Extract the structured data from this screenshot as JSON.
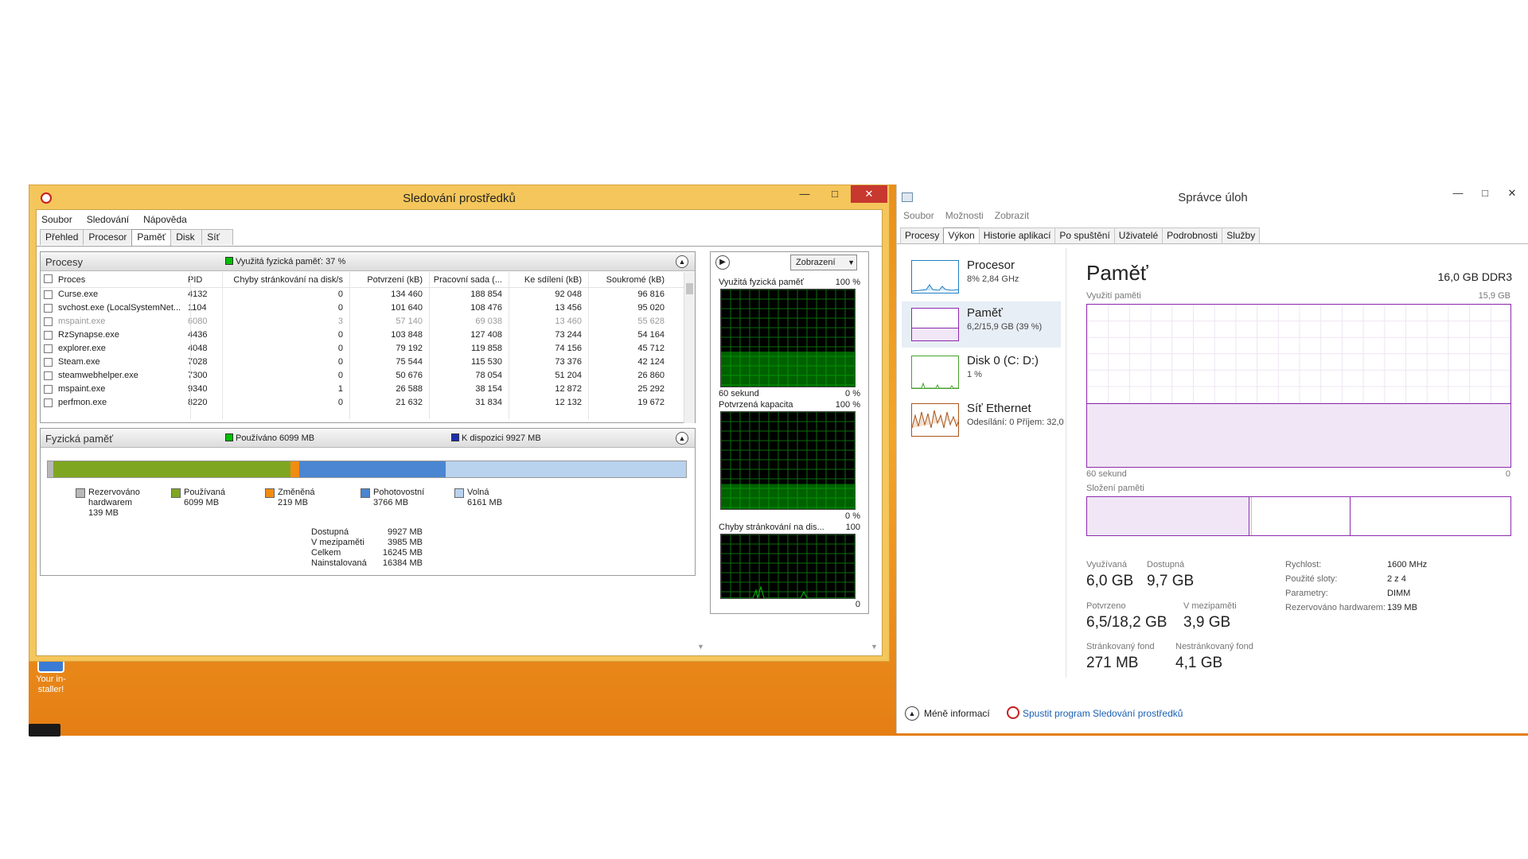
{
  "resmon": {
    "title": "Sledování prostředků",
    "menu": [
      "Soubor",
      "Sledování",
      "Nápověda"
    ],
    "tabs": [
      "Přehled",
      "Procesor",
      "Paměť",
      "Disk",
      "Síť"
    ],
    "active_tab": "Paměť",
    "processes": {
      "title": "Procesy",
      "legend": "Využitá fyzická paměť: 37 %",
      "legend_color": "#00c000",
      "columns": {
        "name": "Proces",
        "pid": "PID",
        "faults": "Chyby stránkování na disk/s",
        "commit": "Potvrzení (kB)",
        "ws": "Pracovní sada (...",
        "share": "Ke sdílení (kB)",
        "priv": "Soukromé (kB)"
      },
      "rows": [
        {
          "name": "Curse.exe",
          "pid": "4132",
          "faults": "0",
          "commit": "134 460",
          "ws": "188 854",
          "share": "92 048",
          "priv": "96 816",
          "dim": false
        },
        {
          "name": "svchost.exe (LocalSystemNet...",
          "pid": "1104",
          "faults": "0",
          "commit": "101 640",
          "ws": "108 476",
          "share": "13 456",
          "priv": "95 020",
          "dim": false
        },
        {
          "name": "mspaint.exe",
          "pid": "6080",
          "faults": "3",
          "commit": "57 140",
          "ws": "69 038",
          "share": "13 460",
          "priv": "55 628",
          "dim": true
        },
        {
          "name": "RzSynapse.exe",
          "pid": "4436",
          "faults": "0",
          "commit": "103 848",
          "ws": "127 408",
          "share": "73 244",
          "priv": "54 164",
          "dim": false
        },
        {
          "name": "explorer.exe",
          "pid": "4048",
          "faults": "0",
          "commit": "79 192",
          "ws": "119 858",
          "share": "74 156",
          "priv": "45 712",
          "dim": false
        },
        {
          "name": "Steam.exe",
          "pid": "7028",
          "faults": "0",
          "commit": "75 544",
          "ws": "115 530",
          "share": "73 376",
          "priv": "42 124",
          "dim": false
        },
        {
          "name": "steamwebhelper.exe",
          "pid": "7300",
          "faults": "0",
          "commit": "50 676",
          "ws": "78 054",
          "share": "51 204",
          "priv": "26 860",
          "dim": false
        },
        {
          "name": "mspaint.exe",
          "pid": "9340",
          "faults": "1",
          "commit": "26 588",
          "ws": "38 154",
          "share": "12 872",
          "priv": "25 292",
          "dim": false
        },
        {
          "name": "perfmon.exe",
          "pid": "8220",
          "faults": "0",
          "commit": "21 632",
          "ws": "31 834",
          "share": "12 132",
          "priv": "19 672",
          "dim": false
        }
      ]
    },
    "physical": {
      "title": "Fyzická paměť",
      "legend_used": "Používáno 6099 MB",
      "legend_used_color": "#00c000",
      "legend_avail": "K dispozici 9927 MB",
      "legend_avail_color": "#1a2fb0",
      "categories": [
        {
          "label": "Rezervováno hardwarem",
          "value_text": "139 MB",
          "mb": 139,
          "color": "#b8b8b8"
        },
        {
          "label": "Používaná",
          "value_text": "6099 MB",
          "mb": 6099,
          "color": "#7fa620"
        },
        {
          "label": "Změněná",
          "value_text": "219 MB",
          "mb": 219,
          "color": "#f08c12"
        },
        {
          "label": "Pohotovostní",
          "value_text": "3766 MB",
          "mb": 3766,
          "color": "#4a86d2"
        },
        {
          "label": "Volná",
          "value_text": "6161 MB",
          "mb": 6161,
          "color": "#b9d3ef"
        }
      ],
      "totals": [
        {
          "label": "Dostupná",
          "value": "9927 MB"
        },
        {
          "label": "V mezipaměti",
          "value": "3985 MB"
        },
        {
          "label": "Celkem",
          "value": "16245 MB"
        },
        {
          "label": "Nainstalovaná",
          "value": "16384 MB"
        }
      ]
    },
    "graphs": {
      "view_button": "Zobrazení",
      "g1_title": "Využitá fyzická paměť",
      "g1_max": "100 %",
      "g1_left": "60 sekund",
      "g1_min": "0 %",
      "g2_title": "Potvrzená kapacita",
      "g2_max": "100 %",
      "g2_min": "0 %",
      "g3_title": "Chyby stránkování na dis...",
      "g3_max": "100",
      "g3_min": "0"
    }
  },
  "taskmgr": {
    "title": "Správce úloh",
    "menu": [
      "Soubor",
      "Možnosti",
      "Zobrazit"
    ],
    "tabs": [
      "Procesy",
      "Výkon",
      "Historie aplikací",
      "Po spuštění",
      "Uživatelé",
      "Podrobnosti",
      "Služby"
    ],
    "active_tab": "Výkon",
    "sidebar": [
      {
        "title": "Procesor",
        "sub": "8% 2,84 GHz",
        "color": "#1c7fc4"
      },
      {
        "title": "Paměť",
        "sub": "6,2/15,9 GB (39 %)",
        "color": "#8b2bb0"
      },
      {
        "title": "Disk 0 (C: D:)",
        "sub": "1 %",
        "color": "#4aa02c"
      },
      {
        "title": "Síť Ethernet",
        "sub": "Odesílání: 0 Příjem: 32,0",
        "color": "#a8561c"
      }
    ],
    "memory": {
      "title": "Paměť",
      "capacity": "16,0 GB DDR3",
      "usage_label": "Využití paměti",
      "usage_max": "15,9 GB",
      "time_label": "60 sekund",
      "time_right": "0",
      "composition_label": "Složení paměti",
      "usage_fraction": 0.39,
      "stats": {
        "in_use_label": "Využívaná",
        "in_use": "6,0 GB",
        "available_label": "Dostupná",
        "available": "9,7 GB",
        "committed_label": "Potvrzeno",
        "committed": "6,5/18,2 GB",
        "cached_label": "V mezipaměti",
        "cached": "3,9 GB",
        "paged_label": "Stránkovaný fond",
        "paged": "271 MB",
        "nonpaged_label": "Nestránkovaný fond",
        "nonpaged": "4,1 GB"
      },
      "specs": [
        {
          "label": "Rychlost:",
          "value": "1600 MHz"
        },
        {
          "label": "Použité sloty:",
          "value": "2 z 4"
        },
        {
          "label": "Parametry:",
          "value": "DIMM"
        },
        {
          "label": "Rezervováno hardwarem:",
          "value": "139 MB"
        }
      ]
    },
    "footer": {
      "less_info": "Méně informací",
      "open_resmon": "Spustit program Sledování prostředků"
    }
  },
  "desktop": {
    "icon_label": "Your in-staller!"
  }
}
